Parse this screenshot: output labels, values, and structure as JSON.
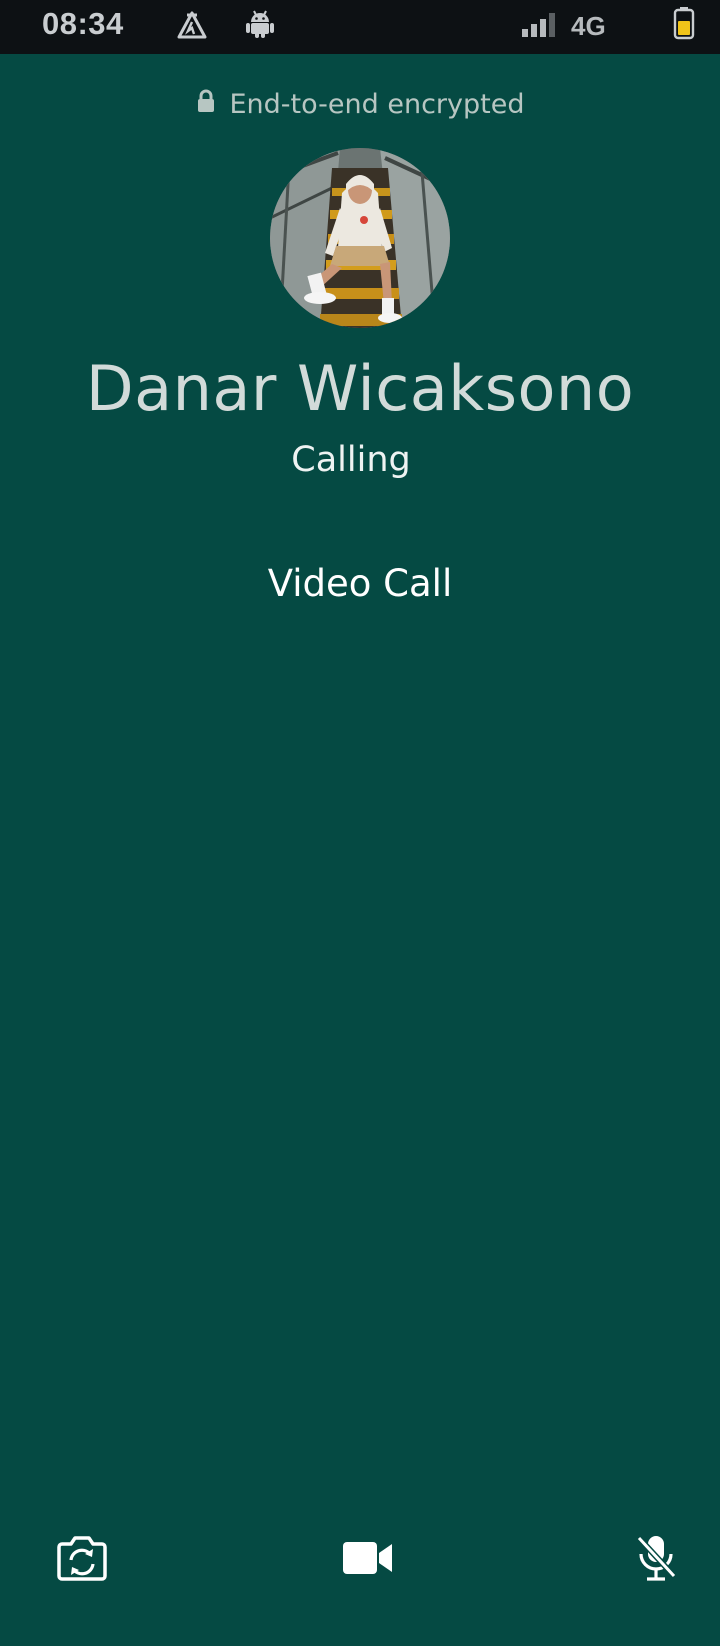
{
  "status_bar": {
    "time": "08:34",
    "network": "4G",
    "icons": [
      "alert-icon",
      "android-icon",
      "signal-icon",
      "battery-icon"
    ],
    "battery_color": "#f0c419"
  },
  "call": {
    "encryption_text": "End-to-end encrypted",
    "caller_name": "Danar Wicaksono",
    "status": "Calling",
    "type": "Video Call"
  },
  "controls": [
    {
      "name": "switch-camera-button",
      "icon": "flip-camera-icon"
    },
    {
      "name": "video-toggle-button",
      "icon": "video-camera-icon"
    },
    {
      "name": "mute-button",
      "icon": "mic-off-icon"
    }
  ],
  "colors": {
    "background": "#054a43",
    "status_bar": "#0d1114",
    "text_primary": "#d2dbd9"
  }
}
